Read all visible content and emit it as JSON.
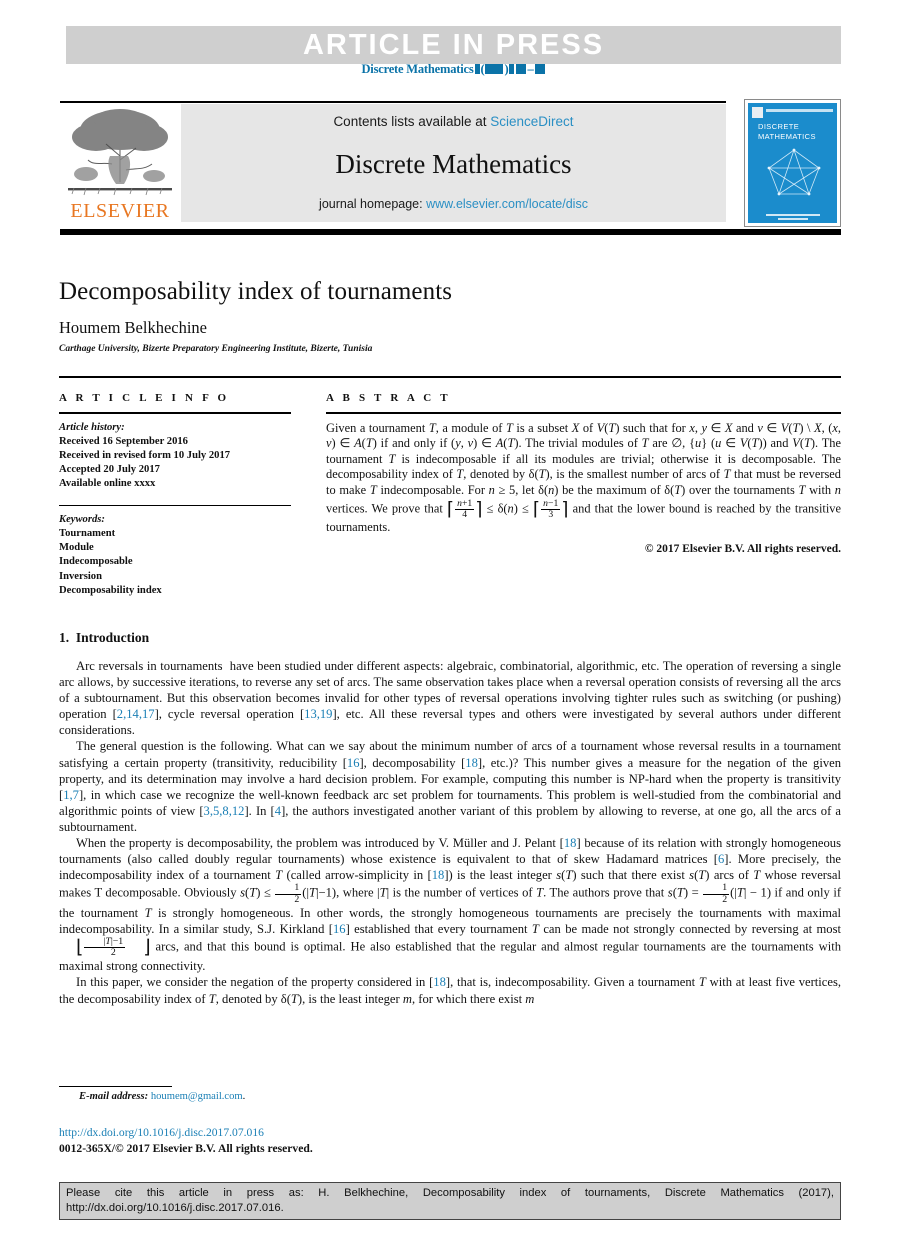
{
  "banner": {
    "article_in_press": "ARTICLE IN PRESS",
    "journal_ref_prefix": "Discrete Mathematics"
  },
  "journal_header": {
    "contents_prefix": "Contents lists available at ",
    "sciencedirect": "ScienceDirect",
    "journal_name": "Discrete Mathematics",
    "homepage_label": "journal homepage: ",
    "homepage_url": "www.elsevier.com/locate/disc",
    "publisher_logo": "ELSEVIER",
    "cover_title_line1": "DISCRETE",
    "cover_title_line2": "MATHEMATICS",
    "accent_blue": "#1b8ccc",
    "link_blue": "#2a8fc4",
    "elsevier_orange": "#e87722"
  },
  "article": {
    "title": "Decomposability index of tournaments",
    "author": "Houmem Belkhechine",
    "affiliation": "Carthage University, Bizerte Preparatory Engineering Institute, Bizerte, Tunisia"
  },
  "article_info": {
    "heading": "A R T I C L E   I N F O",
    "history_label": "Article history:",
    "history": [
      "Received 16 September 2016",
      "Received in revised form 10 July 2017",
      "Accepted 20 July 2017",
      "Available online xxxx"
    ],
    "keywords_label": "Keywords:",
    "keywords": [
      "Tournament",
      "Module",
      "Indecomposable",
      "Inversion",
      "Decomposability index"
    ]
  },
  "abstract": {
    "heading": "A B S T R A C T",
    "text_part1": "Given a tournament ",
    "copyright": "© 2017 Elsevier B.V. All rights reserved."
  },
  "introduction": {
    "section_number": "1.",
    "section_title": "Introduction"
  },
  "footnote": {
    "email_label": "E-mail address:",
    "email": "houmem@gmail.com",
    "email_suffix": ".",
    "doi": "http://dx.doi.org/10.1016/j.disc.2017.07.016",
    "issn_line": "0012-365X/© 2017 Elsevier B.V. All rights reserved."
  },
  "cite_box": {
    "line1": "Please cite this article in press as: H. Belkhechine, Decomposability index of tournaments, Discrete Mathematics (2017),",
    "line2": "http://dx.doi.org/10.1016/j.disc.2017.07.016."
  }
}
